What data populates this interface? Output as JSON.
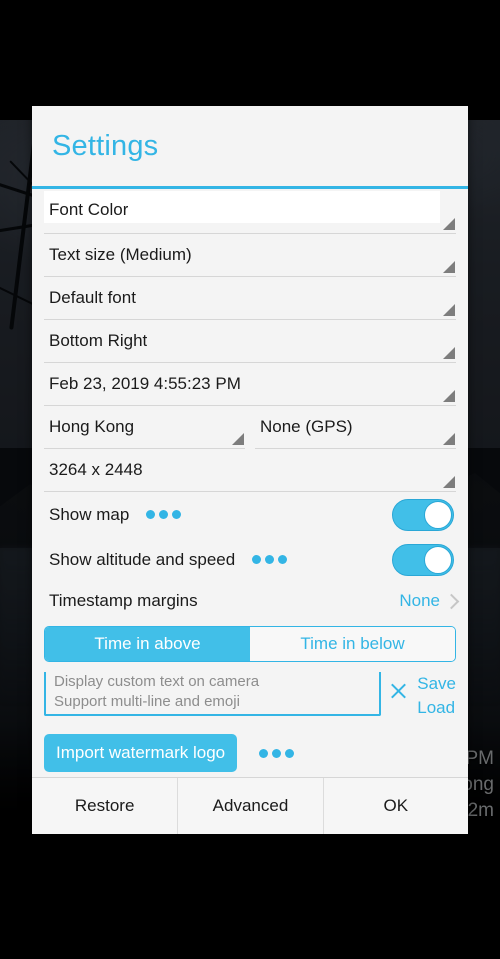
{
  "dialog": {
    "title": "Settings",
    "spinners": [
      {
        "label": "Font Color",
        "kind": "color-swatch",
        "swatch": "#ffffff"
      },
      {
        "label": "Text size (Medium)",
        "kind": "plain"
      },
      {
        "label": "Default font",
        "kind": "plain"
      },
      {
        "label": "Bottom Right",
        "kind": "plain"
      },
      {
        "label": "Feb 23, 2019 4:55:23 PM",
        "kind": "plain"
      }
    ],
    "spinner_pair": [
      {
        "label": "Hong Kong"
      },
      {
        "label": "None (GPS)"
      }
    ],
    "resolution_spinner": {
      "label": "3264 x 2448"
    },
    "switches": [
      {
        "label": "Show map",
        "has_dots": true,
        "state": "on"
      },
      {
        "label": "Show altitude and speed",
        "has_dots": true,
        "state": "on"
      }
    ],
    "chevron_row": {
      "label": "Timestamp margins",
      "value": "None"
    },
    "segmented": {
      "options": [
        {
          "label": "Time in above",
          "selected": true
        },
        {
          "label": "Time in below",
          "selected": false
        }
      ]
    },
    "custom_text": {
      "line1": "Display custom text on camera",
      "line2": "Support multi-line and emoji",
      "value": "",
      "placeholder": "Display custom text on camera",
      "clear_icon": "close-icon",
      "save_label": "Save",
      "load_label": "Load"
    },
    "import": {
      "button_label": "Import watermark logo",
      "has_dots": true
    },
    "footer": {
      "restore_label": "Restore",
      "advanced_label": "Advanced",
      "ok_label": "OK"
    }
  },
  "background": {
    "stamp_line1": "PM",
    "stamp_line2": "ong",
    "stamp_line3": "2m"
  },
  "colors": {
    "accent": "#33b5e5",
    "accent_fill": "#41bfe8",
    "dialog_bg": "#f4f4f4",
    "text": "#1b1b1b",
    "divider": "#d6d6d6"
  }
}
